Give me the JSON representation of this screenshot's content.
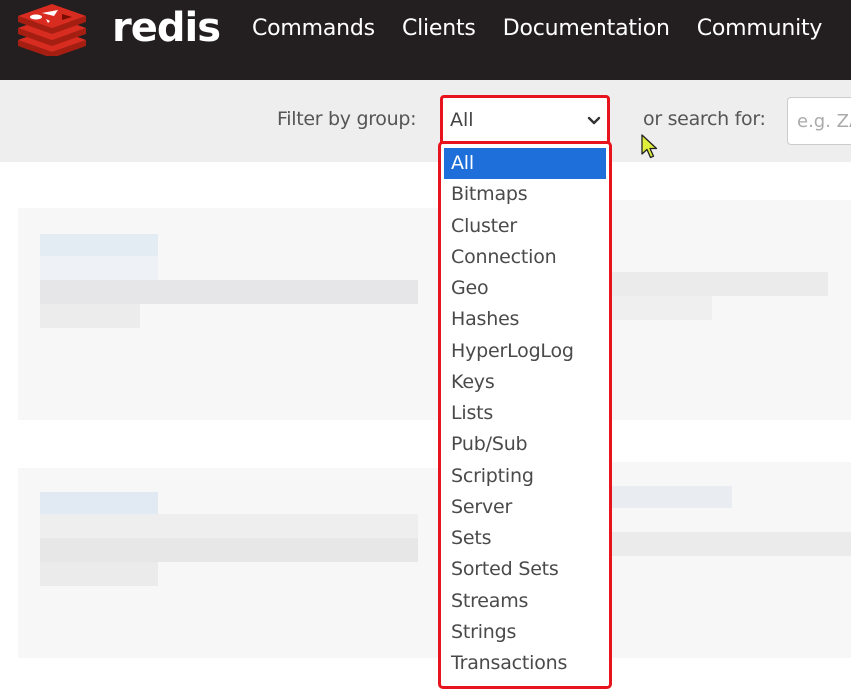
{
  "brand": {
    "name": "redis",
    "logo_icon": "redis-logo-icon",
    "colors": {
      "brand_red": "#d82c20",
      "navbar_bg": "#231e1f"
    }
  },
  "nav": {
    "items": [
      {
        "label": "Commands"
      },
      {
        "label": "Clients"
      },
      {
        "label": "Documentation"
      },
      {
        "label": "Community"
      }
    ]
  },
  "filter": {
    "label": "Filter by group:",
    "selected": "All",
    "chevron_icon": "chevron-down-icon",
    "highlight_color": "#e8141d"
  },
  "search": {
    "label": "or search for:",
    "placeholder": "e.g. ZADD"
  },
  "dropdown": {
    "options": [
      {
        "label": "All",
        "selected": true
      },
      {
        "label": "Bitmaps"
      },
      {
        "label": "Cluster"
      },
      {
        "label": "Connection"
      },
      {
        "label": "Geo"
      },
      {
        "label": "Hashes"
      },
      {
        "label": "HyperLogLog"
      },
      {
        "label": "Keys"
      },
      {
        "label": "Lists"
      },
      {
        "label": "Pub/Sub"
      },
      {
        "label": "Scripting"
      },
      {
        "label": "Server"
      },
      {
        "label": "Sets"
      },
      {
        "label": "Sorted Sets"
      },
      {
        "label": "Streams"
      },
      {
        "label": "Strings"
      },
      {
        "label": "Transactions"
      }
    ],
    "selected_color": "#1e6fd9"
  }
}
